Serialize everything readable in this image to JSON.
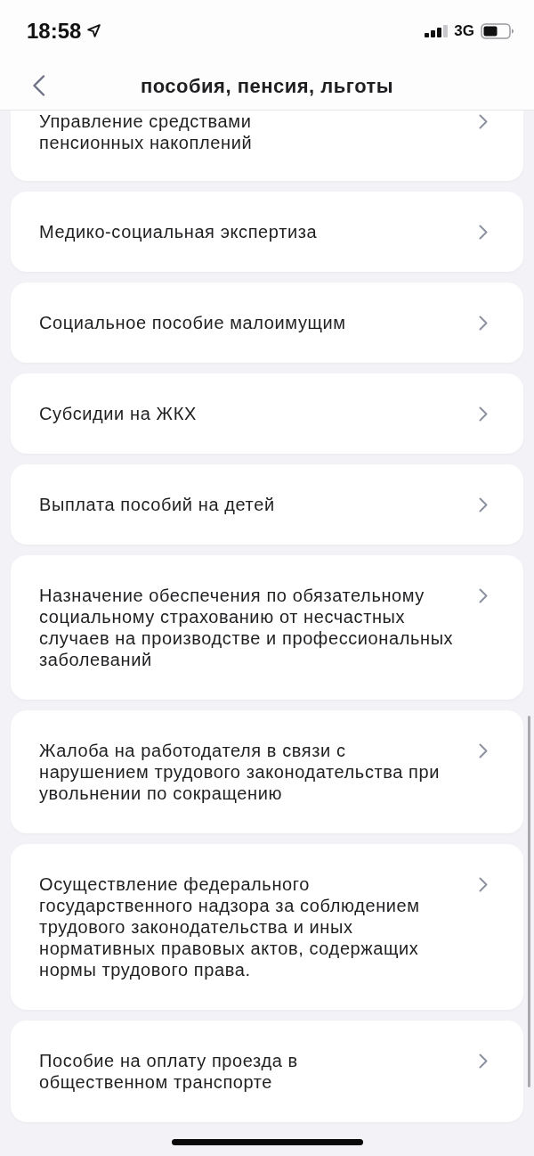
{
  "status_bar": {
    "time": "18:58",
    "network": "3G"
  },
  "header": {
    "title": "пособия, пенсия, льготы"
  },
  "items": [
    {
      "kind": "partial",
      "label": "Управление средствами\nпенсионных накоплений"
    },
    {
      "kind": "full",
      "label": "Медико-социальная экспертиза"
    },
    {
      "kind": "full",
      "label": "Социальное пособие малоимущим"
    },
    {
      "kind": "full",
      "label": "Субсидии на ЖКХ"
    },
    {
      "kind": "full",
      "label": "Выплата пособий на детей"
    },
    {
      "kind": "full",
      "label": "Назначение обеспечения по обязательному социальному страхованию от несчастных случаев на производстве и профессиональных заболеваний"
    },
    {
      "kind": "full",
      "label": "Жалоба на работодателя в связи с нарушением трудового законодательства при увольнении по сокращению"
    },
    {
      "kind": "full",
      "label": "Осуществление федерального государственного надзора за соблюдением трудового законодательства и иных нормативных правовых актов, содержащих нормы трудового права."
    },
    {
      "kind": "full",
      "label": "Пособие на оплату проезда в\nобщественном транспорте"
    }
  ]
}
